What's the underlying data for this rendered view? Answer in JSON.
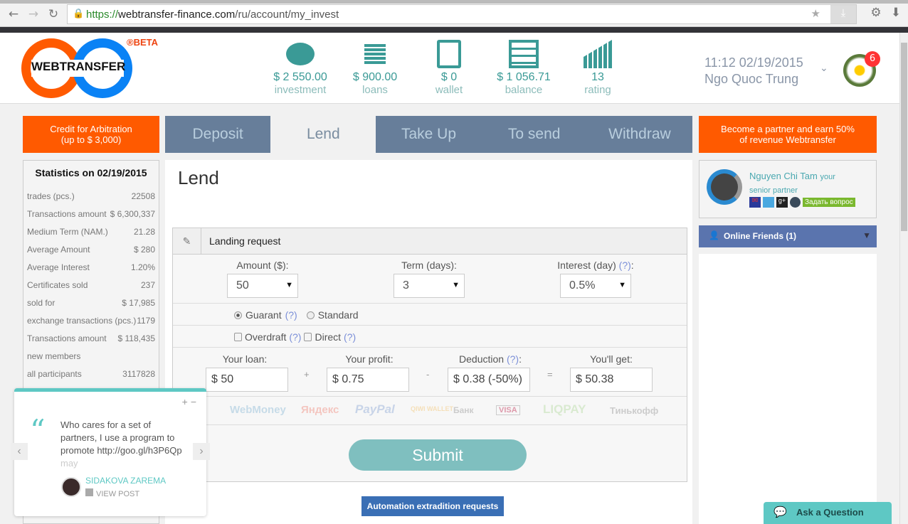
{
  "browser": {
    "url_scheme": "https://",
    "url_host": "webtransfer-finance.com",
    "url_path": "/ru/account/my_invest"
  },
  "header": {
    "logo_text": "WEBTRANSFER",
    "logo_badge": "®BETA",
    "stats": [
      {
        "value": "$ 2 550.00",
        "label": "investment",
        "icon": "piggy-bank-icon"
      },
      {
        "value": "$ 900.00",
        "label": "loans",
        "icon": "coins-icon"
      },
      {
        "value": "$ 0",
        "label": "wallet",
        "icon": "safe-icon"
      },
      {
        "value": "$ 1 056.71",
        "label": "balance",
        "icon": "abacus-icon"
      },
      {
        "value": "13",
        "label": "rating",
        "icon": "growth-chart-icon"
      }
    ],
    "datetime": "11:12 02/19/2015",
    "user_name": "Ngo Quoc Trung",
    "notifications": "6"
  },
  "left_promo": {
    "line1": "Credit for Arbitration",
    "line2": "(up to $ 3,000)"
  },
  "right_promo": {
    "line1": "Become a partner and earn 50%",
    "line2": "of revenue Webtransfer"
  },
  "tabs": [
    "Deposit",
    "Lend",
    "Take Up",
    "To send",
    "Withdraw"
  ],
  "active_tab": "Lend",
  "statistics": {
    "title": "Statistics on 02/19/2015",
    "rows": [
      {
        "label": "trades (pcs.)",
        "value": "22508"
      },
      {
        "label": "Transactions amount",
        "value": "$ 6,300,337"
      },
      {
        "label": "Medium Term (NAM.)",
        "value": "21.28"
      },
      {
        "label": "Average Amount",
        "value": "$ 280"
      },
      {
        "label": "Average Interest",
        "value": "1.20%"
      },
      {
        "label": "Certificates sold",
        "value": "237"
      },
      {
        "label": "sold for",
        "value": "$ 17,985"
      },
      {
        "label": "exchange transactions (pcs.)",
        "value": "1179"
      },
      {
        "label": "Transactions amount",
        "value": "$ 118,435"
      },
      {
        "label": "new members",
        "value": ""
      },
      {
        "label": "all participants",
        "value": "3117828"
      }
    ]
  },
  "main": {
    "title": "Lend",
    "form_title": "Landing request",
    "amount_label": "Amount ($):",
    "amount": "50",
    "term_label": "Term (days):",
    "term": "3",
    "interest_label": "Interest (day)",
    "interest": "0.5%",
    "help": "(?)",
    "guarant": "Guarant",
    "standard": "Standard",
    "overdraft": "Overdraft",
    "direct": "Direct",
    "loan_label": "Your loan:",
    "loan": "$ 50",
    "profit_label": "Your profit:",
    "profit": "$ 0.75",
    "deduction_label": "Deduction",
    "deduction": "$ 0.38 (-50%)",
    "get_label": "You'll get:",
    "get": "$ 50.38",
    "op_plus": "+",
    "op_minus": "-",
    "op_eq": "=",
    "payments": [
      "WebMoney",
      "Яндекс",
      "PayPal",
      "QIWI WALLET",
      "Банк",
      "VISA",
      "LIQPAY",
      "Тинькофф"
    ],
    "submit": "Submit",
    "automation": "Automation extradition requests"
  },
  "partner": {
    "name": "Nguyen Chi Tam",
    "role1": "your",
    "role2": "senior partner",
    "ask": "Задать вопрос"
  },
  "friends": "Online Friends (1)",
  "widget": {
    "quote": "Who cares for a set of partners, I use a program to promote",
    "link": "http://goo.gl/h3P6Qp",
    "fade": "may",
    "author": "SIDAKOVA ZAREMA",
    "view": "VIEW POST",
    "plus": "+",
    "minus": "−"
  },
  "ask_question": "Ask a Question"
}
